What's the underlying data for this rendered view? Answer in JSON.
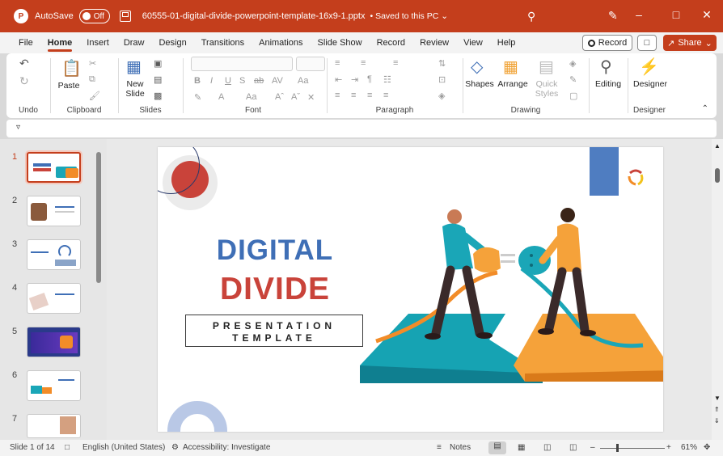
{
  "titlebar": {
    "autosave_label": "AutoSave",
    "autosave_state": "Off",
    "doc_title": "60555-01-digital-divide-powerpoint-template-16x9-1.pptx",
    "save_status": "• Saved to this PC ⌄",
    "logo_letter": "P"
  },
  "menu": {
    "tabs": [
      "File",
      "Home",
      "Insert",
      "Draw",
      "Design",
      "Transitions",
      "Animations",
      "Slide Show",
      "Record",
      "Review",
      "View",
      "Help"
    ],
    "active_tab": "Home",
    "record_label": "Record",
    "share_label": "Share"
  },
  "ribbon": {
    "groups": {
      "undo": "Undo",
      "clipboard": "Clipboard",
      "slides": "Slides",
      "font": "Font",
      "paragraph": "Paragraph",
      "drawing": "Drawing",
      "designer": "Designer"
    },
    "paste_label": "Paste",
    "new_slide_label_1": "New",
    "new_slide_label_2": "Slide",
    "shapes_label": "Shapes",
    "arrange_label": "Arrange",
    "quick_styles_label_1": "Quick",
    "quick_styles_label_2": "Styles",
    "editing_label": "Editing",
    "designer_label": "Designer"
  },
  "thumbnails": {
    "numbers": [
      "1",
      "2",
      "3",
      "4",
      "5",
      "6",
      "7"
    ],
    "selected": "1"
  },
  "slide": {
    "title_line1": "DIGITAL",
    "title_line2": "DIVIDE",
    "subtitle_line1": "PRESENTATION",
    "subtitle_line2": "TEMPLATE"
  },
  "statusbar": {
    "slide_info": "Slide 1 of 14",
    "language": "English (United States)",
    "accessibility": "Accessibility: Investigate",
    "notes": "Notes",
    "zoom": "61%"
  },
  "colors": {
    "accent": "#c43e1c",
    "title_blue": "#3f6fb6",
    "title_red": "#c9433a",
    "teal": "#1aa6b7",
    "orange": "#f28c28"
  }
}
